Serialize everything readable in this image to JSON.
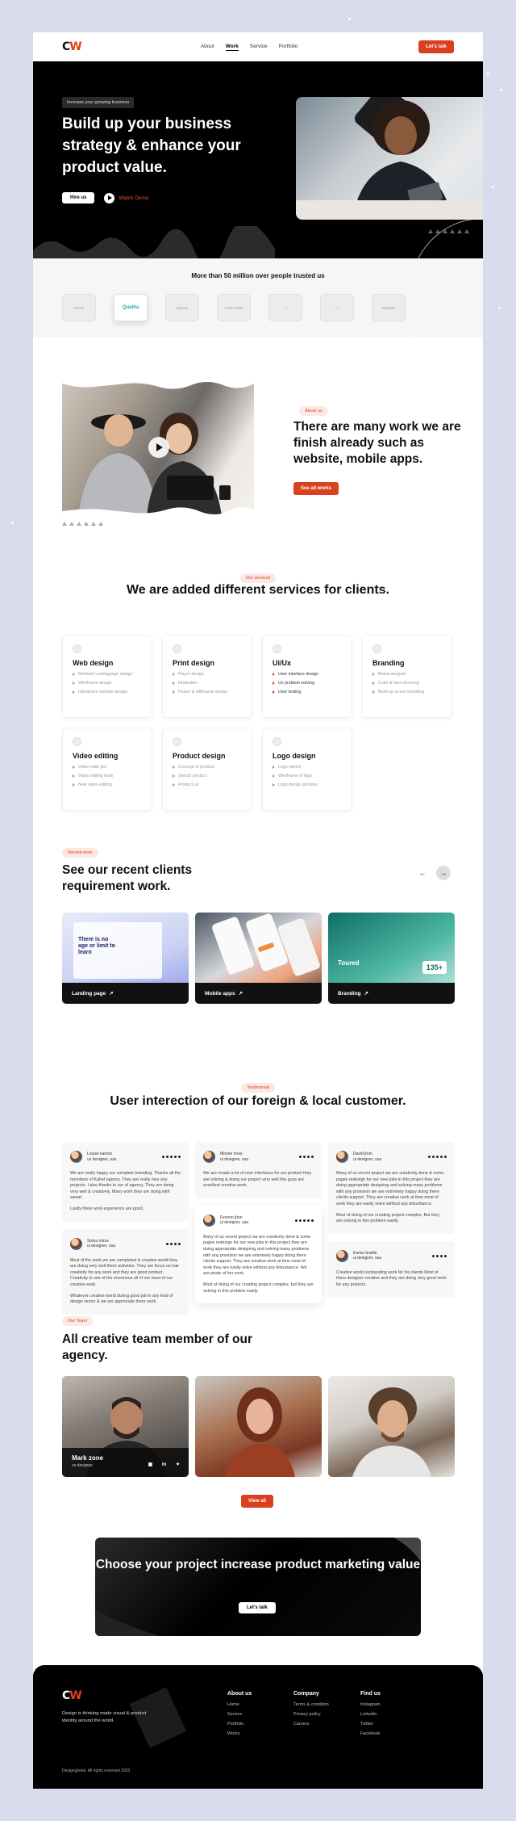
{
  "nav": {
    "logo_c": "C",
    "logo_w": "W",
    "links": [
      "About",
      "Work",
      "Service",
      "Portfolio"
    ],
    "cta": "Let's talk"
  },
  "hero": {
    "tag": "Increase your growing business",
    "title": "Build up your business strategy & enhance your product value.",
    "hire": "Hire us",
    "watch": "Watch Demo"
  },
  "trusted": {
    "title": "More than 50 million over people trusted us",
    "logos": [
      "HEXO",
      "Qualita",
      "Nativity",
      "FORAGER",
      "—",
      "—",
      "Reclaim"
    ]
  },
  "about": {
    "pill": "About us",
    "title": "There are many work we are finish already such as website, mobile apps.",
    "button": "See all works"
  },
  "services": {
    "pill": "Our services",
    "title": "We are added different services for clients.",
    "cards": [
      {
        "name": "Web design",
        "items": [
          "Minimal Landingpage design",
          "Wireframe design",
          "Interactive website design"
        ]
      },
      {
        "name": "Print design",
        "items": [
          "Flayer design",
          "Illustration",
          "Poster & billboards design"
        ]
      },
      {
        "name": "Ui/Ux",
        "items": [
          "User interface design",
          "Ux problem solving",
          "User testing"
        ]
      },
      {
        "name": "Branding",
        "items": [
          "Brand analysis",
          "Color & font choosing",
          "Build up a new branding"
        ]
      },
      {
        "name": "Video editing",
        "items": [
          "Video editz pro",
          "Video editing tools",
          "New video editing"
        ]
      },
      {
        "name": "Product design",
        "items": [
          "Concept of product",
          "Sketch product",
          "Product ux"
        ]
      },
      {
        "name": "Logo design",
        "items": [
          "Logo sketch",
          "Wireframe of logo",
          "Logo design process"
        ]
      }
    ]
  },
  "work": {
    "pill": "Recent work",
    "title": "See our recent clients requirement work.",
    "prev": "←",
    "next": "→",
    "cards": [
      {
        "label": "Landing page",
        "arrow": "↗"
      },
      {
        "label": "Mobile apps",
        "arrow": "↗"
      },
      {
        "label": "Branding",
        "arrow": "↗"
      }
    ],
    "card1_text": "There is no age or limit to learn",
    "card3_text": "Toured",
    "card3_num": "135+"
  },
  "testimonials": {
    "pill": "Testimonial",
    "title": "User interection of our foreign & local customer.",
    "items": [
      {
        "name": "Louise kamon",
        "role": "ux designer, usa",
        "text": [
          "We are really happy our complete branding. Thanks all the members of Kahef agency. They are really nice any projects. I also thanks to our of agency. They are doing very well & creatively. Many work they are doing with sweat.",
          "Lastly there work experience are good."
        ]
      },
      {
        "name": "Soma mirza",
        "role": "ui designer, usa",
        "text": [
          "Most of the work we are completed is creative world they are doing very well there activities. They are focus on hair creativity for any work and they are good product. Creativity is one of the enormous all of our most of our creative work.",
          "Whatever creative world during good job in any kind of design sector & we are appreciate there work."
        ]
      },
      {
        "name": "Monee mooi",
        "role": "ui designer, usa",
        "text": [
          "We are create a lot of user interfaces for our product they are solving & doing our project very well this guys are excellent creative work."
        ]
      },
      {
        "name": "Fenson jhon",
        "role": "ui designer, usa",
        "text": [
          "Many of us recent project we are creatively done & some pages redesign for our new jobs in this project they are doing appropriate designing and solving many problems with any provision we are extremely happy doing there clients support. They are creative work at time most of work they are easily solve without any disturbance. We are pirate of her work.",
          "Most of doing of our creating project complex, but they are solving in this problem easily."
        ]
      },
      {
        "name": "David jhon",
        "role": "ui designer, usa",
        "text": [
          "Many of us recent project we are creatively done & some pages redesign for our new jobs in this project they are doing appropriate designing and solving many problems with any provision we are extremely happy doing there clients support. They are creative work at time most of work they are easily solve without any disturbance.",
          "Most of doing of our creating project complex, But they are solving in this problem easily."
        ]
      },
      {
        "name": "Karlso brattle",
        "role": "ui designer, usa",
        "text": [
          "Creative world outstanding work for his clients Most of there designer creative and they are doing very good work for any projects."
        ]
      }
    ]
  },
  "team": {
    "pill": "Our Team",
    "title": "All creative team member of our agency.",
    "member_name": "Mark zone",
    "member_role": "ux designer",
    "social": [
      "▣",
      "in",
      "✦"
    ],
    "view_all": "View all"
  },
  "cta": {
    "title": "Choose your project increase product marketing value",
    "button": "Let's talk"
  },
  "footer": {
    "desc": "Design is thinking made visual & product identity around the world.",
    "columns": [
      {
        "title": "About us",
        "links": [
          "Home",
          "Service",
          "Portfolio",
          "Works"
        ]
      },
      {
        "title": "Company",
        "links": [
          "Terms & condition",
          "Privacy policy",
          "Careers"
        ]
      },
      {
        "title": "Find us",
        "links": [
          "Instagram",
          "Linkedin",
          "Twitter",
          "Facebook"
        ]
      }
    ],
    "copyright": "Designghetai. All rights reserved 2023"
  },
  "colors": {
    "accent": "#d9411e",
    "background": "#d9dcec",
    "dark": "#000000"
  }
}
